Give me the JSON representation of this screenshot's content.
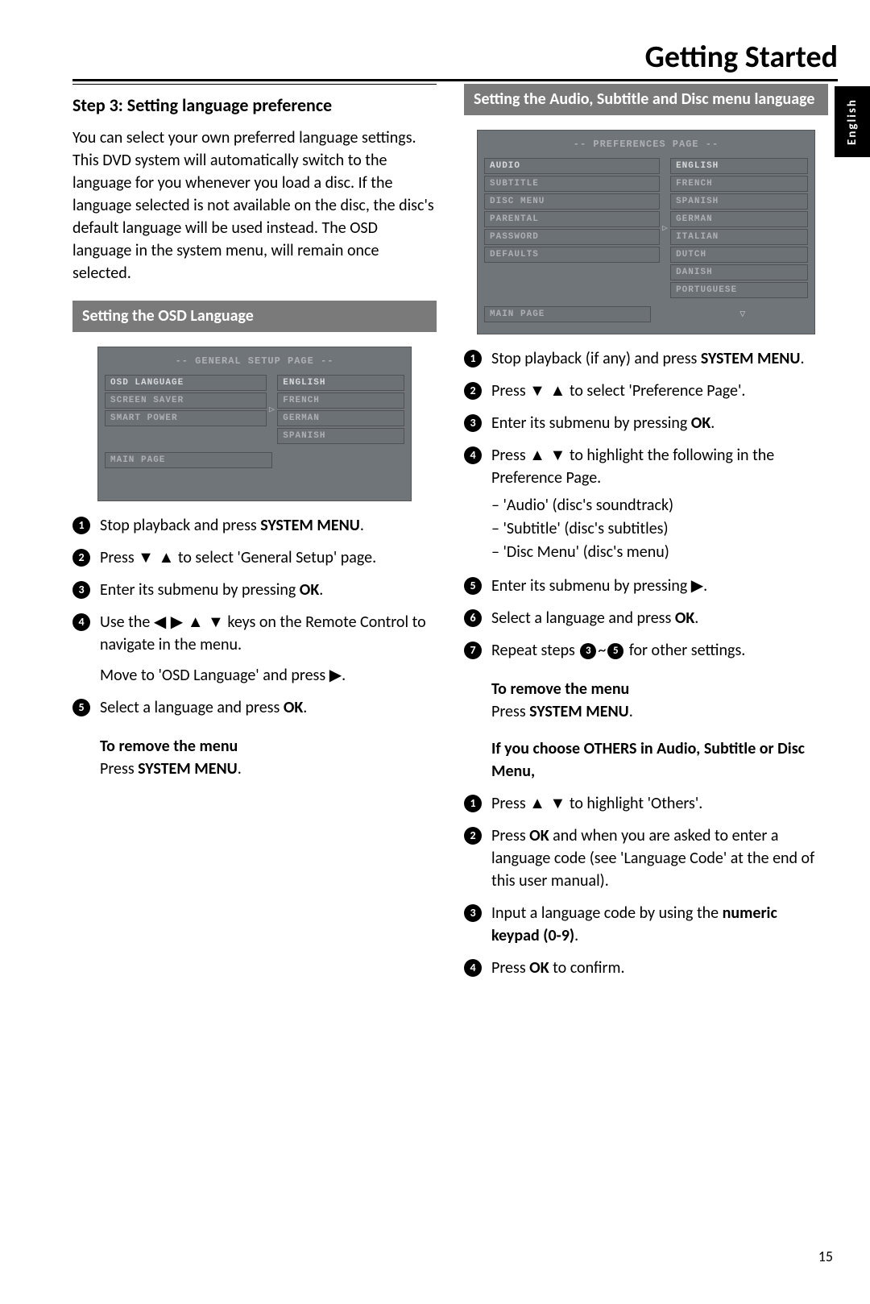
{
  "page_title": "Getting Started",
  "language_tab": "English",
  "page_number": "15",
  "left": {
    "step_title": "Step 3:  Setting language preference",
    "intro": "You can select your own preferred language settings. This DVD system will automatically switch to the language for you whenever you load a disc.  If the language selected is not available on the disc, the disc's default language will be used instead.  The OSD language in the system menu, will remain once selected.",
    "section_bar": "Setting the OSD Language",
    "screenshot": {
      "title": "-- GENERAL SETUP PAGE --",
      "left_items": [
        "OSD LANGUAGE",
        "SCREEN SAVER",
        "SMART POWER"
      ],
      "right_items": [
        "ENGLISH",
        "FRENCH",
        "GERMAN",
        "SPANISH"
      ],
      "main_page": "MAIN PAGE"
    },
    "steps": {
      "s1a": "Stop playback and press ",
      "s1b": "SYSTEM MENU",
      "s1c": ".",
      "s2a": "Press ",
      "s2b": " to select 'General Setup' page.",
      "s3a": "Enter its submenu by pressing ",
      "s3b": "OK",
      "s3c": ".",
      "s4a": "Use the ",
      "s4b": " keys on the Remote Control to navigate in the menu.",
      "s4sub": "Move to 'OSD Language' and press ▶.",
      "s5a": "Select a language and press ",
      "s5b": "OK",
      "s5c": "."
    },
    "remove_title": "To remove the menu",
    "remove_a": "Press ",
    "remove_b": "SYSTEM MENU",
    "remove_c": "."
  },
  "right": {
    "section_bar": "Setting the Audio, Subtitle and Disc menu language",
    "screenshot": {
      "title": "-- PREFERENCES PAGE --",
      "left_items": [
        "AUDIO",
        "SUBTITLE",
        "DISC MENU",
        "PARENTAL",
        "PASSWORD",
        "DEFAULTS"
      ],
      "right_items": [
        "ENGLISH",
        "FRENCH",
        "SPANISH",
        "GERMAN",
        "ITALIAN",
        "DUTCH",
        "DANISH",
        "PORTUGUESE"
      ],
      "main_page": "MAIN PAGE"
    },
    "stepsA": {
      "s1a": "Stop playback (if any) and press ",
      "s1b": "SYSTEM MENU",
      "s1c": ".",
      "s2a": "Press ",
      "s2b": " to select 'Preference Page'.",
      "s3a": "Enter its submenu by pressing ",
      "s3b": "OK",
      "s3c": ".",
      "s4a": "Press ",
      "s4b": " to highlight the following in the Preference Page.",
      "s4_items": [
        "–  'Audio' (disc's soundtrack)",
        "–  'Subtitle' (disc's subtitles)",
        "–  'Disc Menu' (disc's menu)"
      ],
      "s5": "Enter its submenu by pressing ▶.",
      "s6a": "Select a language and press ",
      "s6b": "OK",
      "s6c": ".",
      "s7a": "Repeat steps ",
      "s7b": " for other settings."
    },
    "remove_title": "To remove the menu",
    "remove_a": "Press ",
    "remove_b": "SYSTEM MENU",
    "remove_c": ".",
    "others_title": "If you choose OTHERS in Audio, Subtitle or Disc Menu,",
    "stepsB": {
      "s1a": "Press ",
      "s1b": " to highlight 'Others'.",
      "s2a": "Press ",
      "s2b": "OK",
      "s2c": " and when you are asked to enter a language code (see 'Language Code' at the end of this user manual).",
      "s3a": "Input a language code by using the ",
      "s3b": "numeric keypad (0-9)",
      "s3c": ".",
      "s4a": "Press ",
      "s4b": "OK",
      "s4c": " to confirm."
    }
  }
}
